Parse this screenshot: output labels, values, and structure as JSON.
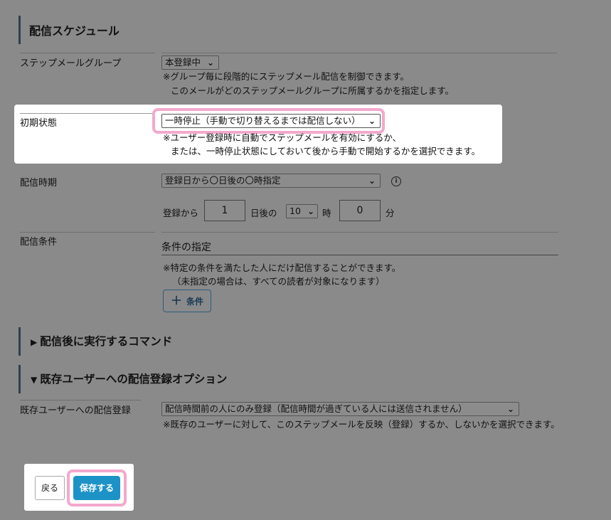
{
  "schedule": {
    "title": "配信スケジュール",
    "step_group": {
      "label": "ステップメールグループ",
      "value": "本登録中",
      "note1": "※グループ毎に段階的にステップメール配信を制御できます。",
      "note2": "このメールがどのステップメールグループに所属するかを指定します。"
    },
    "initial_state": {
      "label": "初期状態",
      "value": "一時停止（手動で切り替えるまでは配信しない）",
      "note1": "※ユーザー登録時に自動でステップメールを有効にするか、",
      "note2": "または、一時停止状態にしておいて後から手動で開始するかを選択できます。"
    },
    "timing": {
      "label": "配信時期",
      "value": "登録日から〇日後の〇時指定",
      "info": "i",
      "from_label": "登録から",
      "days": "1",
      "days_after": "日後の",
      "hour": "10",
      "hour_label": "時",
      "minute": "0",
      "minute_label": "分"
    },
    "condition": {
      "label": "配信条件",
      "heading": "条件の指定",
      "note1": "※特定の条件を満たした人にだけ配信することができます。",
      "note2": "（未指定の場合は、すべての読者が対象になります）",
      "button_plus": "＋",
      "button_label": "条件"
    }
  },
  "post_command": {
    "arrow": "▶",
    "title": "配信後に実行するコマンド"
  },
  "existing_users": {
    "arrow": "▼",
    "title": "既存ユーザーへの配信登録オプション",
    "label": "既存ユーザーへの配信登録",
    "value": "配信時間前の人にのみ登録（配信時間が過ぎている人には送信されません）",
    "note": "※既存のユーザーに対して、このステップメールを反映（登録）するか、しないかを選択できます。"
  },
  "footer": {
    "back_label": "戻る",
    "save_label": "保存する"
  },
  "colors": {
    "overlay": "#8a8a8a",
    "highlight": "#f4a8cc",
    "save_button": "#1c92c7"
  }
}
